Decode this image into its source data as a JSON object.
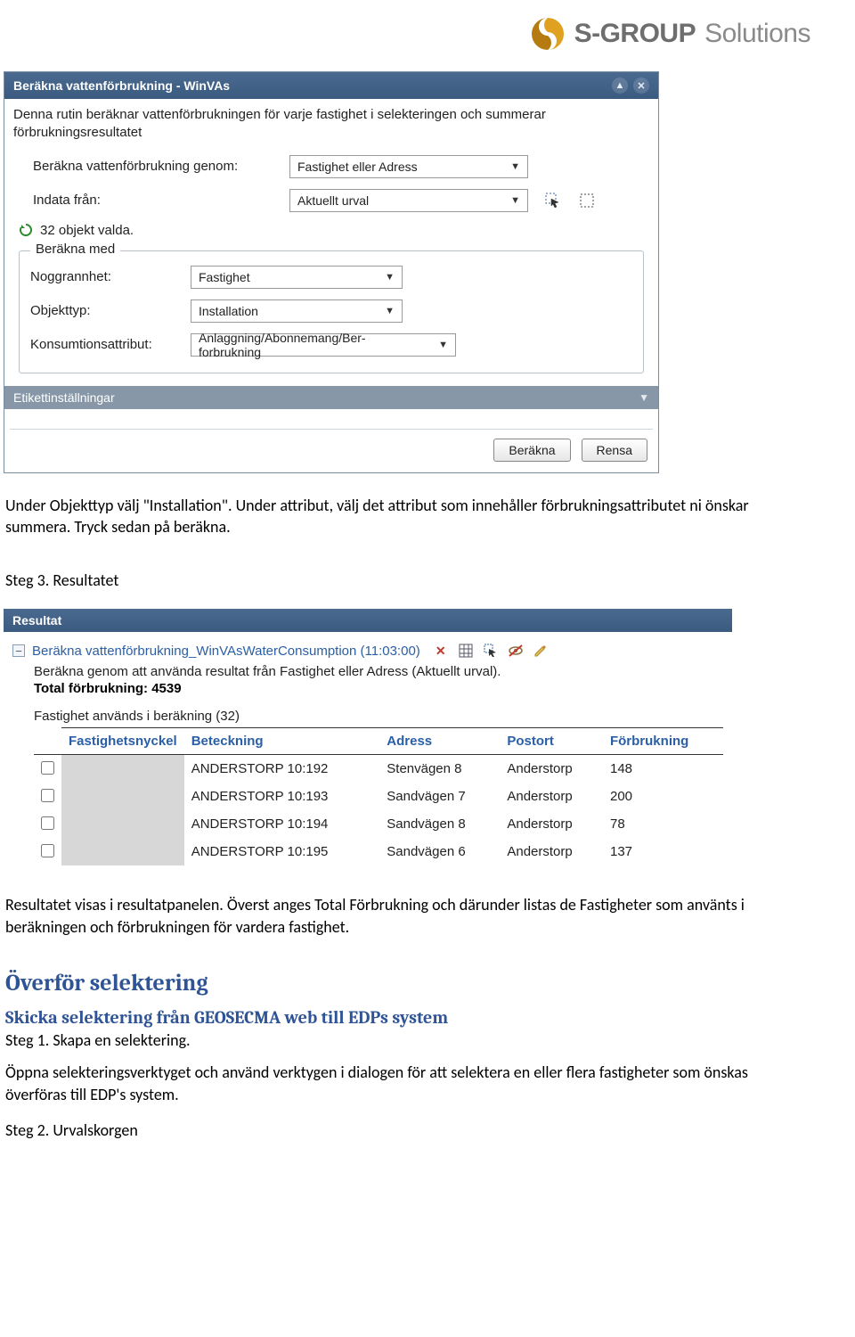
{
  "logo": {
    "bold": "S-GROUP",
    "light": "Solutions"
  },
  "dialog": {
    "title": "Beräkna vattenförbrukning - WinVAs",
    "intro": "Denna rutin beräknar vattenförbrukningen för varje fastighet i selekteringen och summerar förbrukningsresultatet",
    "row1_label": "Beräkna vattenförbrukning genom:",
    "row1_value": "Fastighet eller Adress",
    "row2_label": "Indata från:",
    "row2_value": "Aktuellt urval",
    "status": "32 objekt valda.",
    "fieldset_legend": "Beräkna med",
    "fs_noggr_label": "Noggrannhet:",
    "fs_noggr_value": "Fastighet",
    "fs_obj_label": "Objekttyp:",
    "fs_obj_value": "Installation",
    "fs_kon_label": "Konsumtionsattribut:",
    "fs_kon_value": "Anlaggning/Abonnemang/Ber-forbrukning",
    "subheader": "Etikettinställningar",
    "btn_calc": "Beräkna",
    "btn_clear": "Rensa"
  },
  "doc1": {
    "p1": "Under Objekttyp välj \"Installation\". Under attribut, välj det attribut som innehåller förbrukningsattributet ni önskar summera. Tryck sedan på beräkna.",
    "step3": "Steg 3. Resultatet"
  },
  "result": {
    "title": "Resultat",
    "link": "Beräkna vattenförbrukning_WinVAsWaterConsumption (11:03:00)",
    "meta": "Beräkna genom att använda resultat från Fastighet eller Adress (Aktuellt urval).",
    "total": "Total förbrukning: 4539",
    "sub": "Fastighet används i beräkning (32)",
    "cols": [
      "Fastighetsnyckel",
      "Beteckning",
      "Adress",
      "Postort",
      "Förbrukning"
    ],
    "rows": [
      {
        "bet": "ANDERSTORP 10:192",
        "adr": "Stenvägen 8",
        "ort": "Anderstorp",
        "forb": "148"
      },
      {
        "bet": "ANDERSTORP 10:193",
        "adr": "Sandvägen 7",
        "ort": "Anderstorp",
        "forb": "200"
      },
      {
        "bet": "ANDERSTORP 10:194",
        "adr": "Sandvägen 8",
        "ort": "Anderstorp",
        "forb": "78"
      },
      {
        "bet": "ANDERSTORP 10:195",
        "adr": "Sandvägen 6",
        "ort": "Anderstorp",
        "forb": "137"
      }
    ]
  },
  "doc2": {
    "p1": "Resultatet visas i resultatpanelen. Överst anges Total Förbrukning och därunder listas de Fastigheter som använts i beräkningen och förbrukningen för vardera fastighet.",
    "h2": "Överför selektering",
    "h3": "Skicka selektering från GEOSECMA web till EDPs system",
    "step1": "Steg 1. Skapa en selektering.",
    "p2": "Öppna selekteringsverktyget och använd verktygen i dialogen för att selektera en eller flera fastigheter som önskas överföras till EDP's system.",
    "step2": "Steg 2. Urvalskorgen"
  }
}
